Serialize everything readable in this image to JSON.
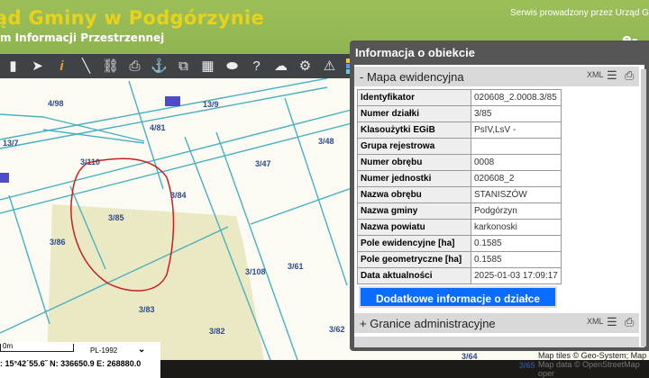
{
  "header": {
    "title": "ąd Gminy w Podgórzynie",
    "subtitle": "m Informacji Przestrzennej",
    "service": "Serwis prowadzony przez Urząd G",
    "brand": "e-"
  },
  "toolbar": {
    "icons": [
      "menu-icon",
      "pointer-icon",
      "info-icon",
      "measure-icon",
      "link-icon",
      "print-icon",
      "anchor-icon",
      "compare-icon",
      "layout-icon",
      "shape-icon",
      "help-icon",
      "cloud-download-icon",
      "settings-icon",
      "warning-icon",
      "color-grid-icon"
    ]
  },
  "map": {
    "parcels": [
      "4/98",
      "13/9",
      "4/81",
      "13/7",
      "3/48",
      "3/110",
      "3/47",
      "3/84",
      "3/85",
      "3/86",
      "3/61",
      "3/108",
      "3/83",
      "3/82",
      "3/62",
      "3/64",
      "3/65"
    ],
    "scale": "0m",
    "crs": "PL-1992",
    "coords": ": 15°42´55.6˝  N: 336650.9  E: 268880.0",
    "attribution1": "Map tiles © Geo-System; Map",
    "attribution2": "Map data © OpenStreetMap oper"
  },
  "panel": {
    "title": "Informacja o obiekcie",
    "section1": "-  Mapa ewidencyjna",
    "section2": "+  Granice administracyjne",
    "xml": "XML",
    "rows": [
      {
        "k": "Identyfikator",
        "v": "020608_2.0008.3/85"
      },
      {
        "k": "Numer działki",
        "v": "3/85"
      },
      {
        "k": "Klasoużytki EGiB",
        "v": "PsIV,LsV -"
      },
      {
        "k": "Grupa rejestrowa",
        "v": ""
      },
      {
        "k": "Numer obrębu",
        "v": "0008"
      },
      {
        "k": "Numer jednostki",
        "v": "020608_2"
      },
      {
        "k": "Nazwa obrębu",
        "v": "STANISZÓW"
      },
      {
        "k": "Nazwa gminy",
        "v": "Podgórzyn"
      },
      {
        "k": "Nazwa powiatu",
        "v": "karkonoski"
      },
      {
        "k": "Pole ewidencyjne [ha]",
        "v": "0.1585"
      },
      {
        "k": "Pole geometryczne [ha]",
        "v": "0.1585"
      },
      {
        "k": "Data aktualności",
        "v": "2025-01-03 17:09:17"
      }
    ],
    "button": "Dodatkowe informacje o działce"
  }
}
